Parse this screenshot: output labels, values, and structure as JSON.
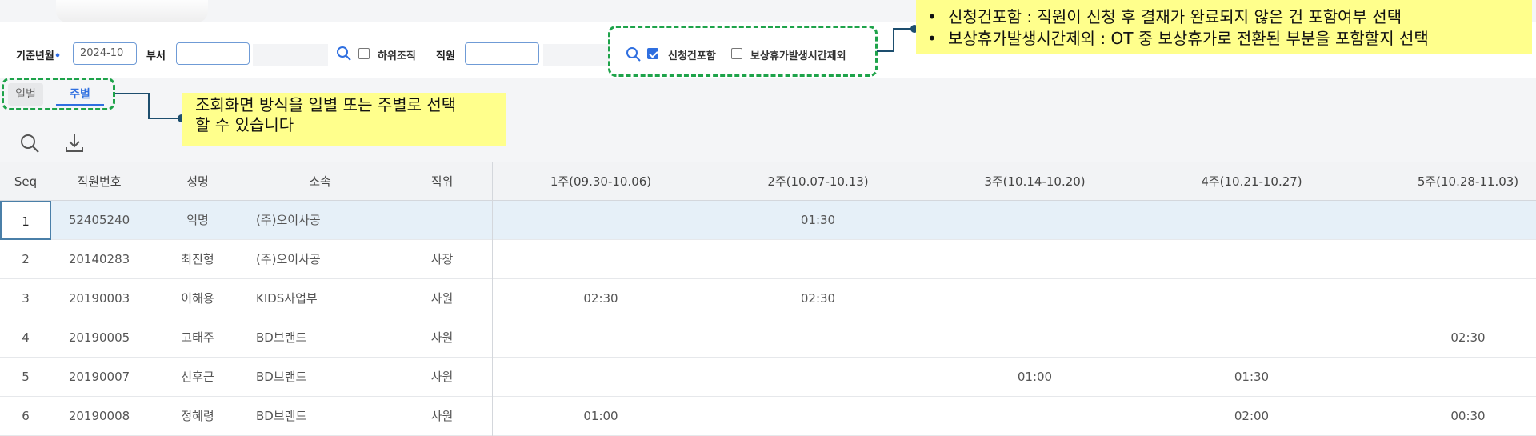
{
  "filters": {
    "base_month_label": "기준년월",
    "required_mark": "•",
    "base_month_value": "2024-10",
    "department_label": "부서",
    "department_value": "",
    "sub_org_label": "하위조직",
    "employee_label": "직원",
    "employee_value": "",
    "include_applications_label": "신청건포함",
    "include_applications_checked": true,
    "exclude_comp_leave_label": "보상휴가발생시간제외",
    "exclude_comp_leave_checked": false
  },
  "tabs": [
    {
      "label": "일별",
      "active": false
    },
    {
      "label": "주별",
      "active": true
    }
  ],
  "toolbar": {
    "search_icon": "search-icon",
    "download_icon": "download-icon"
  },
  "grid": {
    "columns": [
      "Seq",
      "직원번호",
      "성명",
      "소속",
      "직위",
      "1주(09.30-10.06)",
      "2주(10.07-10.13)",
      "3주(10.14-10.20)",
      "4주(10.21-10.27)",
      "5주(10.28-11.03)"
    ],
    "rows": [
      [
        "1",
        "52405240",
        "익명",
        "(주)오이사공",
        "",
        "",
        "01:30",
        "",
        "",
        ""
      ],
      [
        "2",
        "20140283",
        "최진형",
        "(주)오이사공",
        "사장",
        "",
        "",
        "",
        "",
        ""
      ],
      [
        "3",
        "20190003",
        "이해용",
        "KIDS사업부",
        "사원",
        "02:30",
        "02:30",
        "",
        "",
        ""
      ],
      [
        "4",
        "20190005",
        "고태주",
        "BD브랜드",
        "사원",
        "",
        "",
        "",
        "",
        "02:30"
      ],
      [
        "5",
        "20190007",
        "선후근",
        "BD브랜드",
        "사원",
        "",
        "",
        "01:00",
        "01:30",
        ""
      ],
      [
        "6",
        "20190008",
        "정혜령",
        "BD브랜드",
        "사원",
        "01:00",
        "",
        "",
        "02:00",
        "00:30"
      ]
    ],
    "selected_row": 0
  },
  "annotations": {
    "view_mode_note": [
      "조회화면 방식을 일별 또는 주별로 선택",
      "할 수 있습니다"
    ],
    "checkbox_notes": [
      "신청건포함 : 직원이 신청 후 결재가 완료되지 않은 건 포함여부 선택",
      "보상휴가발생시간제외 : OT 중 보상휴가로 전환된 부분을 포함할지 선택"
    ]
  },
  "colors": {
    "accent": "#2f6fe0",
    "highlight_row": "#e6f0f8",
    "callout_bg": "#ffff8c",
    "dash_border": "#1ea34a"
  }
}
